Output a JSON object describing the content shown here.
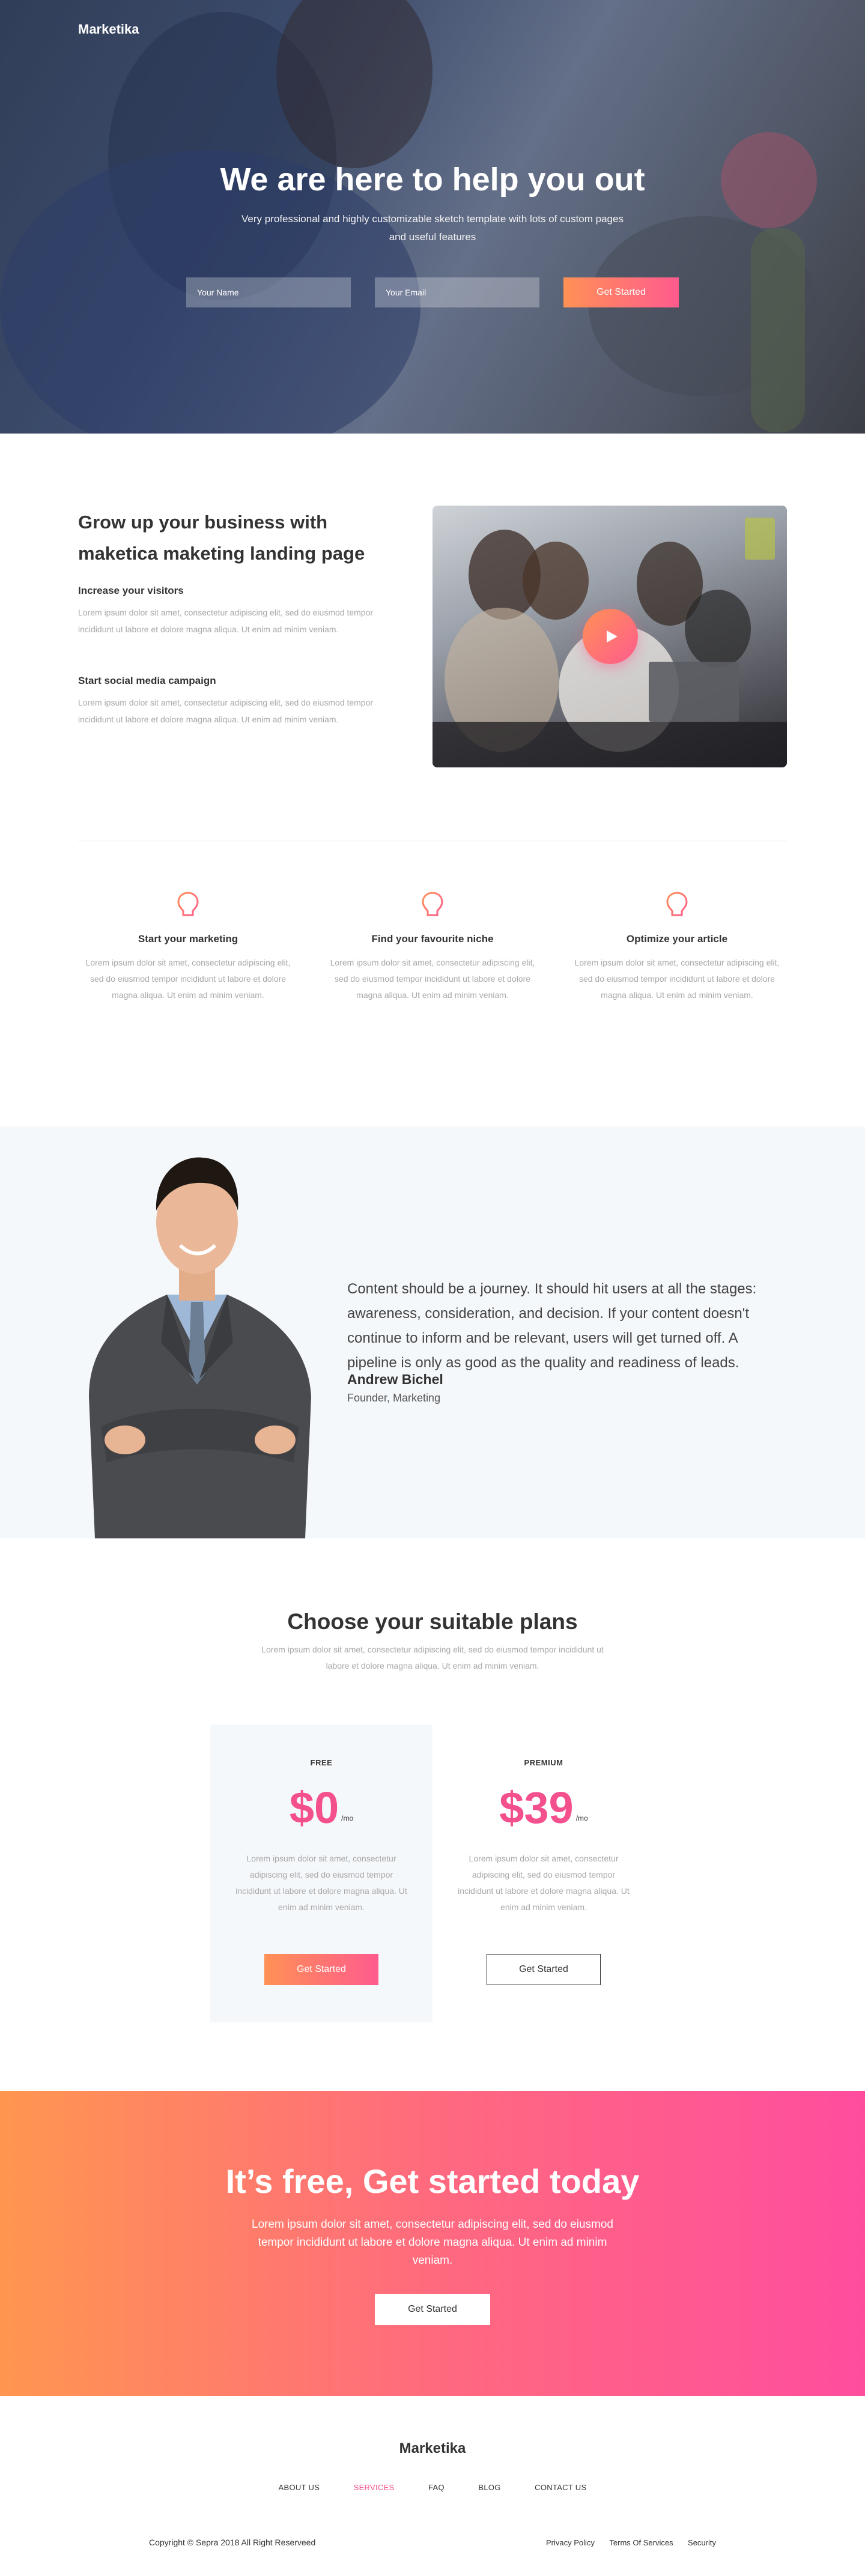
{
  "brand": "Marketika",
  "hero": {
    "title": "We are here to help you out",
    "subtitle": "Very professional and highly customizable sketch template with lots of custom pages and useful features",
    "name_placeholder": "Your Name",
    "email_placeholder": "Your Email",
    "cta_label": "Get Started"
  },
  "grow": {
    "heading": "Grow up your business with maketica maketing landing page",
    "items": [
      {
        "title": "Increase your visitors",
        "text": "Lorem ipsum dolor sit amet, consectetur adipiscing elit, sed do eiusmod tempor incididunt ut labore et dolore magna aliqua. Ut enim ad minim veniam."
      },
      {
        "title": "Start social media campaign",
        "text": "Lorem ipsum dolor sit amet, consectetur adipiscing elit, sed do eiusmod tempor incididunt ut labore et dolore magna aliqua. Ut enim ad minim veniam."
      }
    ]
  },
  "features": [
    {
      "title": "Start your marketing",
      "text": "Lorem ipsum dolor sit amet, consectetur adipiscing elit, sed do eiusmod tempor incididunt ut labore et dolore magna aliqua. Ut enim ad minim veniam.",
      "icon": "lightbulb-icon"
    },
    {
      "title": "Find your favourite niche",
      "text": "Lorem ipsum dolor sit amet, consectetur adipiscing elit, sed do eiusmod tempor incididunt ut labore et dolore magna aliqua. Ut enim ad minim veniam.",
      "icon": "lightbulb-icon"
    },
    {
      "title": "Optimize your article",
      "text": "Lorem ipsum dolor sit amet, consectetur adipiscing elit, sed do eiusmod tempor incididunt ut labore et dolore magna aliqua. Ut enim ad minim veniam.",
      "icon": "lightbulb-icon"
    }
  ],
  "testimonial": {
    "quote": "Content should be a journey. It should hit users at all the stages: awareness, consideration, and decision. If your content doesn't continue to inform and be relevant, users will get turned off. A pipeline is only as good as the quality and readiness of leads.",
    "author": "Andrew Bichel",
    "role": "Founder, Marketing"
  },
  "pricing": {
    "title": "Choose your suitable plans",
    "subtitle": "Lorem ipsum dolor sit amet, consectetur adipiscing elit, sed do eiusmod tempor incididunt ut labore et dolore magna aliqua. Ut enim ad minim veniam.",
    "plans": [
      {
        "name": "FREE",
        "price": "$0",
        "period": "/mo",
        "text": "Lorem ipsum dolor sit amet, consectetur adipiscing elit, sed do eiusmod tempor incididunt ut labore et dolore magna aliqua. Ut enim ad minim veniam.",
        "cta": "Get Started"
      },
      {
        "name": "PREMIUM",
        "price": "$39",
        "period": "/mo",
        "text": "Lorem ipsum dolor sit amet, consectetur adipiscing elit, sed do eiusmod tempor incididunt ut labore et dolore magna aliqua. Ut enim ad minim veniam.",
        "cta": "Get Started"
      }
    ]
  },
  "cta": {
    "title": "It’s free, Get started today",
    "text": "Lorem ipsum dolor sit amet, consectetur adipiscing elit, sed do eiusmod tempor incididunt ut labore et dolore magna aliqua. Ut enim ad minim veniam.",
    "button": "Get Started"
  },
  "footer": {
    "brand": "Marketika",
    "nav": [
      "ABOUT US",
      "SERVICES",
      "FAQ",
      "BLOG",
      "CONTACT US"
    ],
    "active_nav": "SERVICES",
    "copyright": "Copyright © Sepra 2018 All Right Reserveed",
    "legal": [
      "Privacy Policy",
      "Terms Of Services",
      "Security"
    ]
  },
  "colors": {
    "accent_pink": "#f4508e",
    "gradient_start": "#ff9155",
    "gradient_end": "#ff5b8e",
    "light_bg": "#f5f8fb"
  }
}
